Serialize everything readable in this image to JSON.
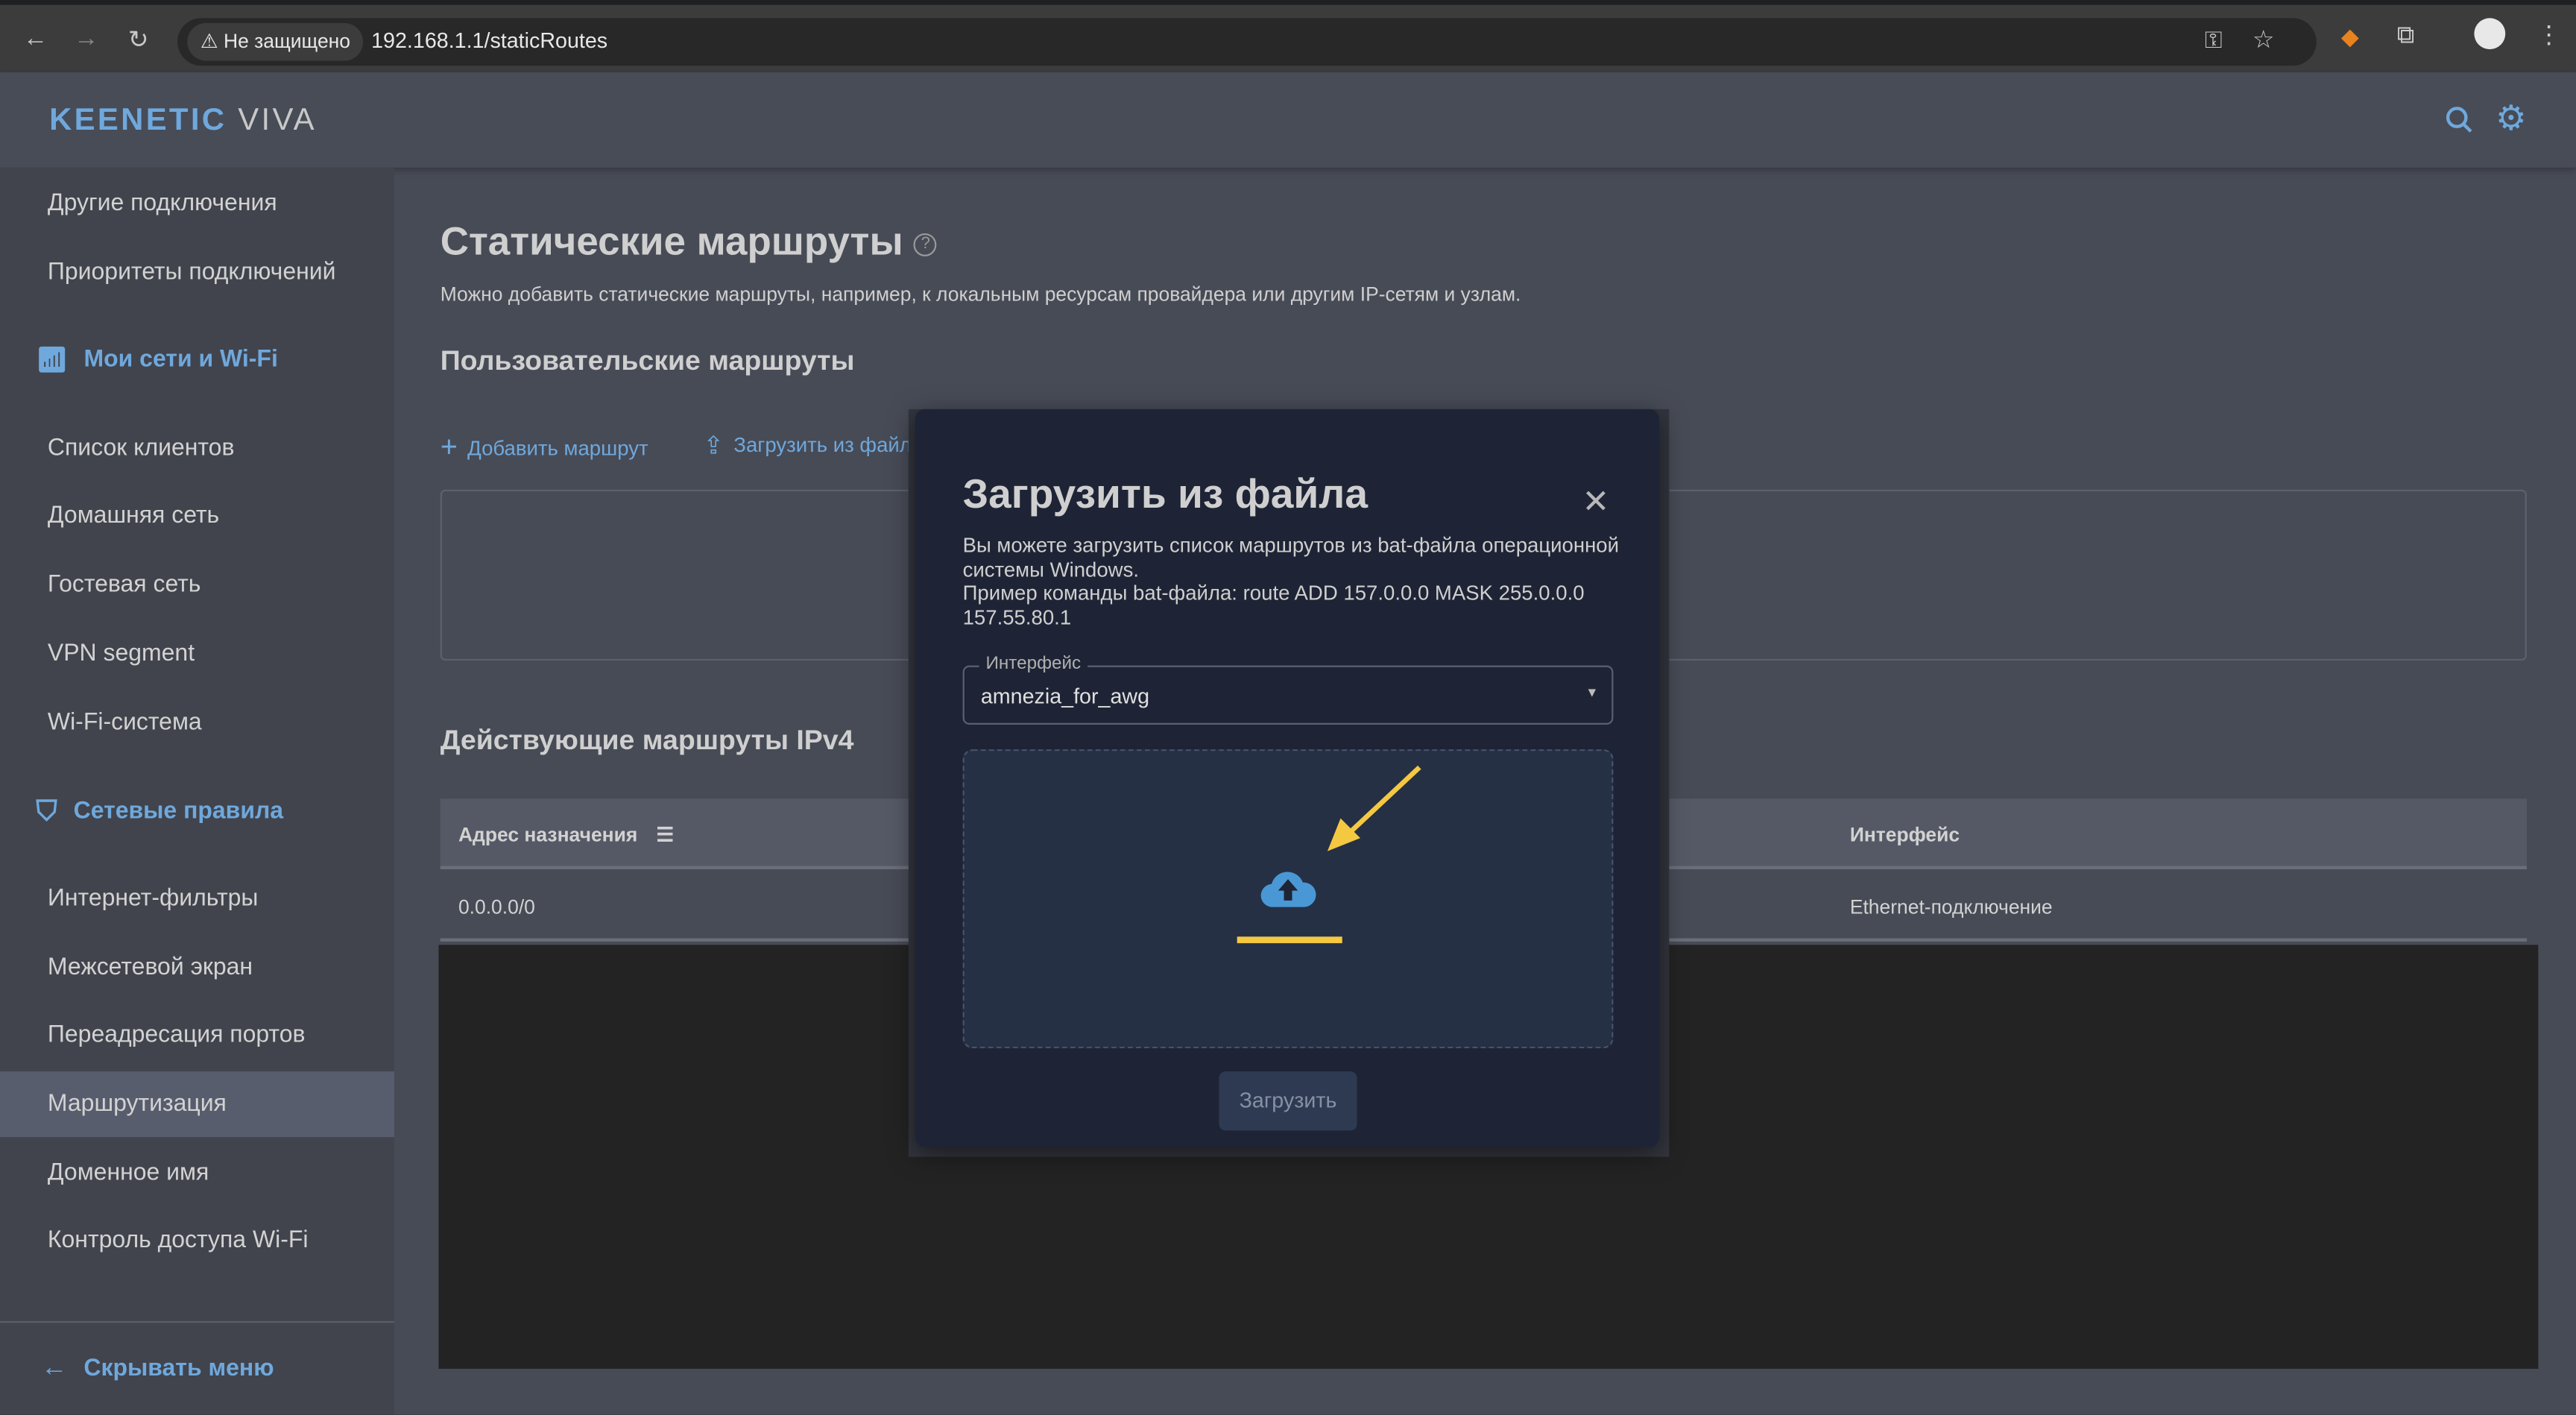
{
  "browser": {
    "security_label": "Не защищено",
    "url": "192.168.1.1/staticRoutes",
    "icons": [
      "back-icon",
      "forward-icon",
      "reload-icon",
      "key-icon",
      "star-icon",
      "metamask-icon",
      "extensions-icon",
      "profile-icon",
      "menu-icon"
    ]
  },
  "header": {
    "brand": "KEENETIC",
    "model": "VIVA"
  },
  "sidebar": {
    "items_top": [
      "Другие подключения",
      "Приоритеты подключений"
    ],
    "section1": "Мои сети и Wi-Fi",
    "items1": [
      "Список клиентов",
      "Домашняя сеть",
      "Гостевая сеть",
      "VPN segment",
      "Wi-Fi-система"
    ],
    "section2": "Сетевые правила",
    "items2": [
      "Интернет-фильтры",
      "Межсетевой экран",
      "Переадресация портов",
      "Маршрутизация",
      "Доменное имя",
      "Контроль доступа Wi-Fi"
    ],
    "active": "Маршрутизация",
    "hide_menu": "Скрывать меню"
  },
  "main": {
    "title": "Статические маршруты",
    "description": "Можно добавить статические маршруты, например, к локальным ресурсам провайдера или другим IP-сетям и узлам.",
    "user_routes_title": "Пользовательские маршруты",
    "add_route": "Добавить маршрут",
    "load_from_file": "Загрузить из файла",
    "active_routes_title": "Действующие маршруты IPv4",
    "table": {
      "columns": [
        "Адрес назначения",
        "Интерфейс"
      ],
      "rows": [
        [
          "0.0.0.0/0",
          "Ethernet-подключение"
        ]
      ]
    }
  },
  "dialog": {
    "title": "Загрузить из файла",
    "text1": "Вы можете загрузить список маршрутов из bat-файла операционной системы Windows.",
    "text2": "Пример команды bat-файла: route ADD 157.0.0.0 MASK 255.0.0.0 157.55.80.1",
    "interface_label": "Интерфейс",
    "interface_value": "amnezia_for_awg",
    "upload_button": "Загрузить"
  },
  "colors": {
    "accent": "#6fa8dc",
    "annotation": "#f5c842",
    "dialog_bg": "#1e2435"
  }
}
